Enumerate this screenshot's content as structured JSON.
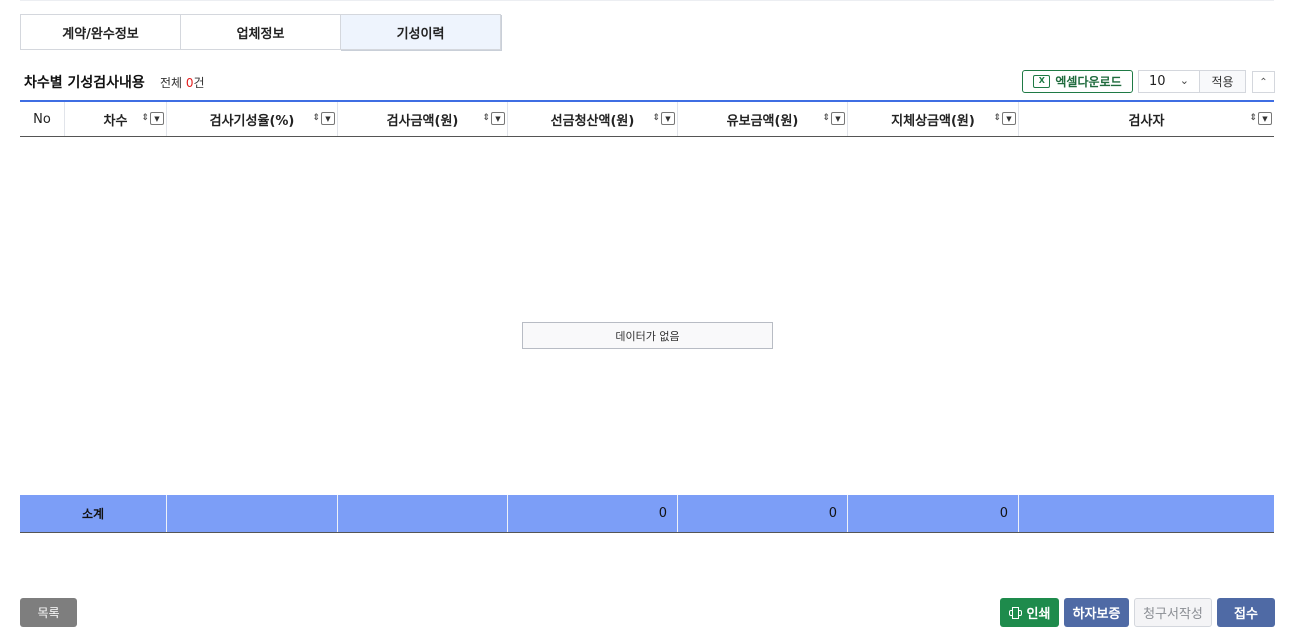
{
  "tabs": [
    {
      "label": "계약/완수정보"
    },
    {
      "label": "업체정보"
    },
    {
      "label": "기성이력"
    }
  ],
  "active_tab": "기성이력",
  "section": {
    "title": "차수별 기성검사내용",
    "total_prefix": "전체 ",
    "total_count": "0",
    "total_suffix": "건"
  },
  "toolbar": {
    "excel_label": "엑셀다운로드",
    "excel_icon_text": "X",
    "page_size": "10",
    "apply_label": "적용",
    "collapse_icon": "chevron-up-icon"
  },
  "grid": {
    "columns": [
      {
        "label": "No",
        "sortable": false
      },
      {
        "label": "차수",
        "sortable": true
      },
      {
        "label": "검사기성율(%)",
        "sortable": true
      },
      {
        "label": "검사금액(원)",
        "sortable": true
      },
      {
        "label": "선금청산액(원)",
        "sortable": true
      },
      {
        "label": "유보금액(원)",
        "sortable": true
      },
      {
        "label": "지체상금액(원)",
        "sortable": true
      },
      {
        "label": "검사자",
        "sortable": true
      }
    ],
    "empty_message": "데이터가 없음",
    "footer": {
      "label": "소계",
      "values": [
        "",
        "",
        "0",
        "0",
        "0",
        ""
      ]
    }
  },
  "buttons": {
    "list": "목록",
    "print": "인쇄",
    "warranty": "하자보증",
    "claim": "청구서작성",
    "receive": "접수"
  },
  "colors": {
    "accent_border": "#3f6ee3",
    "footer_bg": "#7c9ef7",
    "excel_green": "#1f7a45",
    "print_green": "#1e8b4c",
    "navy_button": "#4f6aa5",
    "count_red": "#e11d1d"
  }
}
